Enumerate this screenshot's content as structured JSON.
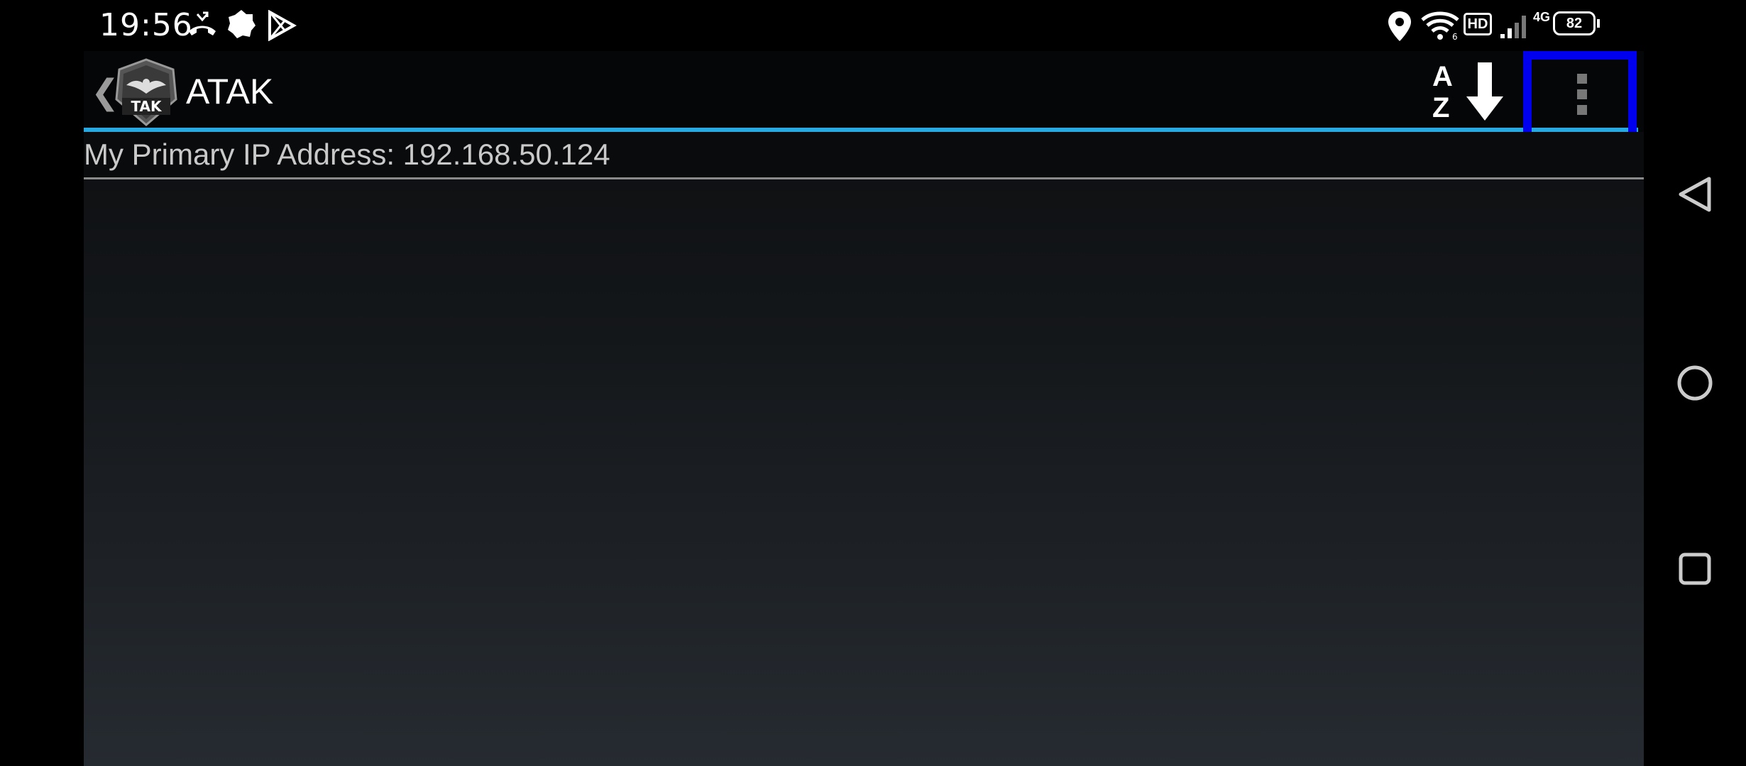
{
  "status_bar": {
    "time": "19:56",
    "left_icons": [
      "missed-call-icon",
      "settings-badge-icon",
      "play-store-icon"
    ],
    "right_icons": [
      "location-icon",
      "wifi-icon",
      "hd-icon",
      "signal-icon",
      "network-4g-icon",
      "battery-icon"
    ],
    "hd_label": "HD",
    "network_label": "4G",
    "battery_level": "82"
  },
  "action_bar": {
    "title": "ATAK",
    "logo_text": "TAK",
    "sort_a": "A",
    "sort_z": "Z"
  },
  "content": {
    "ip_label": "My Primary IP Address: 192.168.50.124"
  },
  "nav_bar": {
    "buttons": [
      "back-icon",
      "home-icon",
      "recents-icon"
    ]
  },
  "colors": {
    "accent": "#27a9e1",
    "highlight": "#0000ee"
  }
}
